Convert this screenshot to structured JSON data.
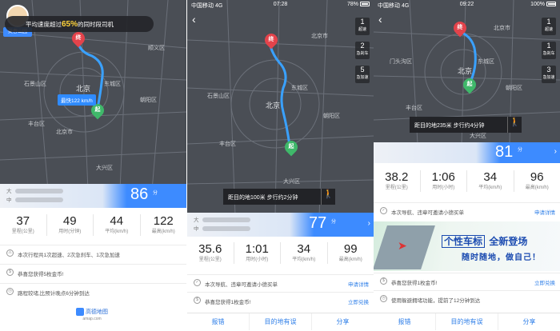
{
  "panel1": {
    "badge_label": "美春山园",
    "banner_prefix": "平均速度超过",
    "banner_percent": "65%",
    "banner_suffix": "的同时段司机",
    "fastest_tag": "最快122 km/h",
    "pin_end": "终",
    "pin_start": "起",
    "cities": [
      "北京",
      "石景山区",
      "北京市",
      "朝阳区",
      "丰台区",
      "东城区",
      "顺义区",
      "大兴区"
    ],
    "score": "86",
    "score_unit": "分",
    "names": [
      "大",
      "中"
    ],
    "stats": [
      {
        "value": "37",
        "label": "里程(公里)"
      },
      {
        "value": "49",
        "label": "用时(分钟)"
      },
      {
        "value": "44",
        "label": "平均(km/h)"
      },
      {
        "value": "122",
        "label": "最高(km/h)"
      }
    ],
    "rows": [
      {
        "text": "本次行程共1次超速、2次急刹车、1次急加速"
      },
      {
        "text": "恭喜您获得5枚金币!"
      },
      {
        "text": "路程较堵,比预计晚点6分钟到达"
      }
    ],
    "logo_name": "高德地图",
    "logo_url": "amap.com"
  },
  "panel2": {
    "status": {
      "carrier": "中国移动  4G",
      "time": "07:28",
      "battery": "78%"
    },
    "side_buttons": [
      {
        "num": "1",
        "label": "超速"
      },
      {
        "num": "2",
        "label": "急刹车"
      },
      {
        "num": "5",
        "label": "急加速"
      }
    ],
    "pin_end": "终",
    "pin_start": "起",
    "cities": [
      "北京",
      "石景山区",
      "朝阳区",
      "丰台区",
      "东城区",
      "大兴区",
      "北京市"
    ],
    "walk_text": "距目的地100米 步行约2分钟",
    "score": "77",
    "score_unit": "分",
    "names": [
      "大",
      "中"
    ],
    "stats": [
      {
        "value": "35.6",
        "label": "里程(公里)"
      },
      {
        "value": "1:01",
        "label": "用时(小时)"
      },
      {
        "value": "34",
        "label": "平均(km/h)"
      },
      {
        "value": "99",
        "label": "最高(km/h)"
      }
    ],
    "rows": [
      {
        "text": "本次导航、违章可邀请小德买单",
        "link": "申请详情"
      },
      {
        "text": "恭喜您获得1枚金币!",
        "link": "立即兑换"
      }
    ],
    "bottom": [
      "报错",
      "目的地有误",
      "分享"
    ]
  },
  "panel3": {
    "status": {
      "carrier": "中国移动  4G",
      "time": "09:22",
      "battery": "100%"
    },
    "side_buttons": [
      {
        "num": "1",
        "label": "超速"
      },
      {
        "num": "1",
        "label": "急刹车"
      },
      {
        "num": "3",
        "label": "急加速"
      }
    ],
    "pin_end": "终",
    "pin_start": "起",
    "cities": [
      "北京",
      "朝阳区",
      "丰台区",
      "东城区",
      "大兴区",
      "门头沟区",
      "北京市"
    ],
    "walk_text": "距目的地235米 步行约4分钟",
    "score": "81",
    "score_unit": "分",
    "stats": [
      {
        "value": "38.2",
        "label": "里程(公里)"
      },
      {
        "value": "1:06",
        "label": "用时(小时)"
      },
      {
        "value": "34",
        "label": "平均(km/h)"
      },
      {
        "value": "96",
        "label": "最高(km/h)"
      }
    ],
    "row_top": {
      "text": "本次导航、违章可邀请小德买单",
      "link": "申请详情"
    },
    "banner_title": "个性车标",
    "banner_title_rest": "全新登场",
    "banner_sub": "随时随地，做自己！",
    "rows": [
      {
        "text": "恭喜您获得1枚金币!",
        "link": "立即兑换"
      },
      {
        "text": "使用躲避拥堵功能，提前了12分钟到达"
      }
    ],
    "bottom": [
      "报错",
      "目的地有误",
      "分享"
    ]
  }
}
